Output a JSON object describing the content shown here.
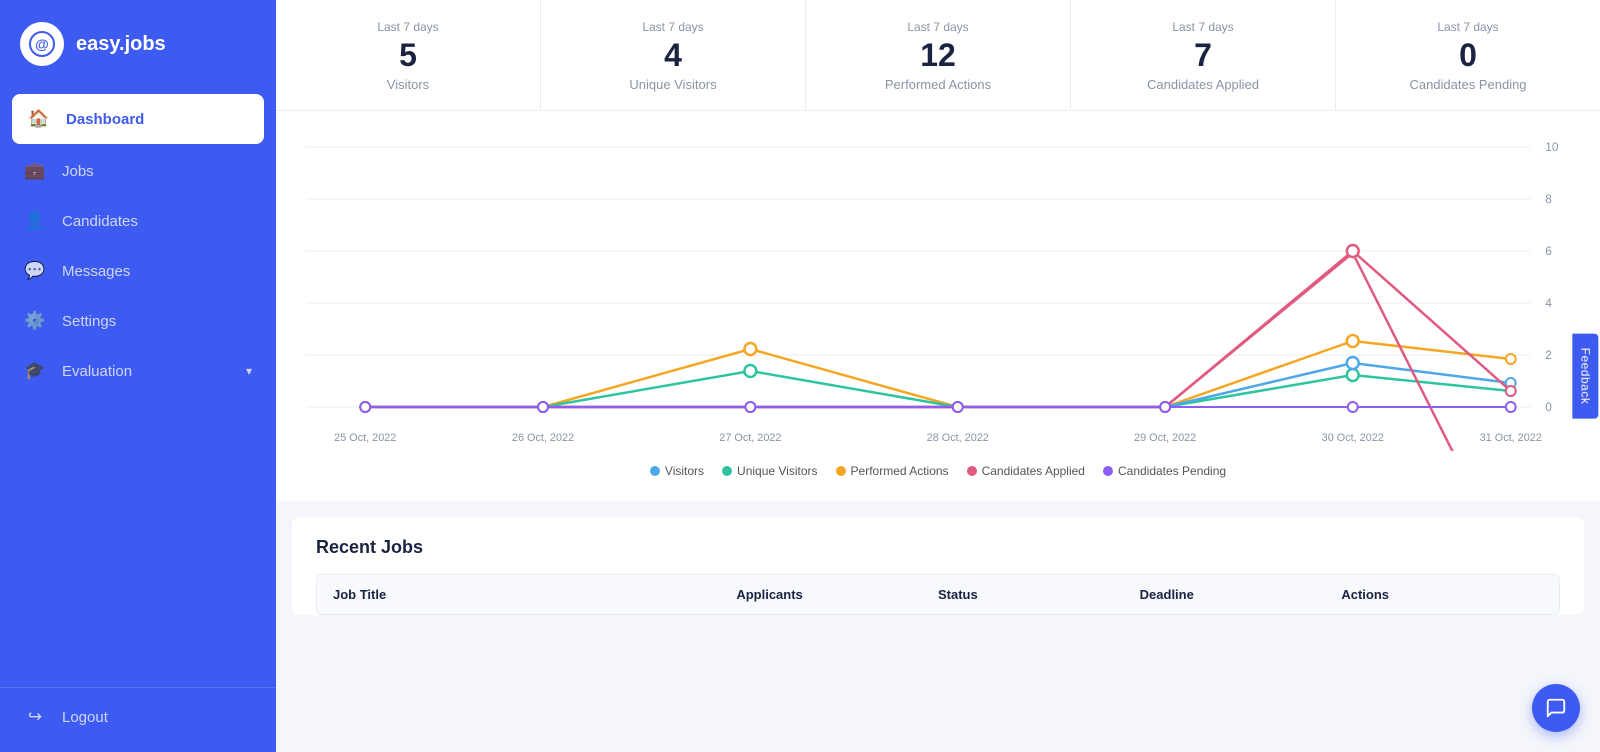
{
  "sidebar": {
    "logo_text": "easy.jobs",
    "items": [
      {
        "id": "dashboard",
        "label": "Dashboard",
        "icon": "🏠",
        "active": true
      },
      {
        "id": "jobs",
        "label": "Jobs",
        "icon": "💼",
        "active": false
      },
      {
        "id": "candidates",
        "label": "Candidates",
        "icon": "👤",
        "active": false
      },
      {
        "id": "messages",
        "label": "Messages",
        "icon": "💬",
        "active": false
      },
      {
        "id": "settings",
        "label": "Settings",
        "icon": "⚙️",
        "active": false
      },
      {
        "id": "evaluation",
        "label": "Evaluation",
        "icon": "🎓",
        "active": false,
        "has_chevron": true
      }
    ],
    "logout_label": "Logout"
  },
  "stats": [
    {
      "period": "Last 7 days",
      "value": "5",
      "label": "Visitors"
    },
    {
      "period": "Last 7 days",
      "value": "4",
      "label": "Unique Visitors"
    },
    {
      "period": "Last 7 days",
      "value": "12",
      "label": "Performed Actions"
    },
    {
      "period": "Last 7 days",
      "value": "7",
      "label": "Candidates Applied"
    },
    {
      "period": "Last 7 days",
      "value": "0",
      "label": "Candidates Pending"
    }
  ],
  "chart": {
    "dates": [
      "25 Oct, 2022",
      "26 Oct, 2022",
      "27 Oct, 2022",
      "28 Oct, 2022",
      "29 Oct, 2022",
      "30 Oct, 2022",
      "31 Oct, 2022"
    ],
    "y_labels": [
      "0",
      "2",
      "4",
      "6",
      "8",
      "10"
    ],
    "legend": [
      {
        "label": "Visitors",
        "color": "#4da8e8"
      },
      {
        "label": "Unique Visitors",
        "color": "#2ec4a0"
      },
      {
        "label": "Performed Actions",
        "color": "#f5a623"
      },
      {
        "label": "Candidates Applied",
        "color": "#e05b7f"
      },
      {
        "label": "Candidates Pending",
        "color": "#8b5cf6"
      }
    ]
  },
  "recent_jobs": {
    "title": "Recent Jobs",
    "columns": [
      "Job Title",
      "Applicants",
      "Status",
      "Deadline",
      "Actions"
    ]
  },
  "feedback_label": "Feedback"
}
